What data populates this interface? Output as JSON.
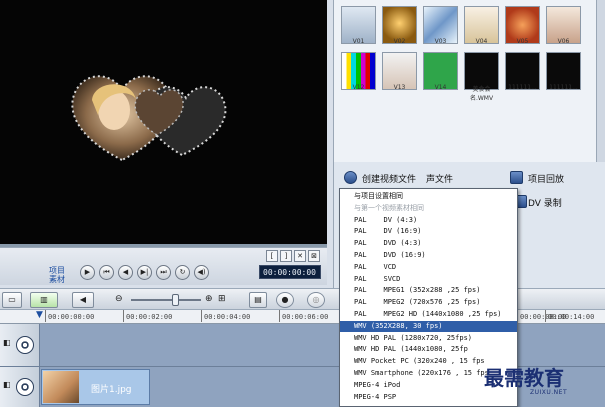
{
  "preview": {
    "art_icon": "heart-photo-frame"
  },
  "player": {
    "mode_project": "项目",
    "mode_clip": "素材",
    "timecode": "00:00:00:00",
    "mini_buttons": [
      "[",
      "]",
      "✕",
      "⊠"
    ],
    "controls": [
      "▶",
      "⏮",
      "◀",
      "▶|",
      "⏭",
      "↻",
      "◀)"
    ]
  },
  "timeline": {
    "ruler": [
      "00:00:00:00",
      "00:00:02:00",
      "00:00:04:00",
      "00:00:06:00",
      "00:00:08:00",
      "00:00:14:00"
    ],
    "clip_name": "图片1.jpg"
  },
  "library": {
    "row1": [
      "V01",
      "V02",
      "V03",
      "V04",
      "V05",
      "V06"
    ],
    "row2": [
      "V12",
      "V13",
      "V14",
      "美食会名.WMV",
      "111111...",
      "111111..."
    ]
  },
  "share": {
    "create_video": "创建视频文件",
    "sound_file": "声文件",
    "project_playback": "项目回放",
    "dv_record": "DV 录制"
  },
  "menu": {
    "items": [
      {
        "label": "与项目设置相同",
        "state": "head"
      },
      {
        "label": "与第一个视频素材相同",
        "state": "disabled"
      },
      {
        "label": "PAL    DV (4:3)",
        "state": "normal"
      },
      {
        "label": "PAL    DV (16:9)",
        "state": "normal"
      },
      {
        "label": "PAL    DVD (4:3)",
        "state": "normal"
      },
      {
        "label": "PAL    DVD (16:9)",
        "state": "normal"
      },
      {
        "label": "PAL    VCD",
        "state": "normal"
      },
      {
        "label": "PAL    SVCD",
        "state": "normal"
      },
      {
        "label": "PAL    MPEG1 (352x288 ,25 fps)",
        "state": "normal"
      },
      {
        "label": "PAL    MPEG2 (720x576 ,25 fps)",
        "state": "normal"
      },
      {
        "label": "PAL    MPEG2 HD (1440x1080 ,25 fps)",
        "state": "normal"
      },
      {
        "label": "WMV (352X288, 30 fps)",
        "state": "selected"
      },
      {
        "label": "WMV HD PAL (1280x720, 25fps)",
        "state": "normal"
      },
      {
        "label": "WMV HD PAL (1440x1080, 25fp",
        "state": "normal"
      },
      {
        "label": "WMV Pocket PC (320x240 , 15 fps",
        "state": "normal"
      },
      {
        "label": "WMV Smartphone (220x176 , 15 fps",
        "state": "normal"
      },
      {
        "label": "MPEG-4 iPod",
        "state": "normal"
      },
      {
        "label": "MPEG-4 PSP",
        "state": "normal"
      }
    ]
  },
  "watermark": {
    "main": "最需教育",
    "sub": "ZUIXU.NET"
  }
}
